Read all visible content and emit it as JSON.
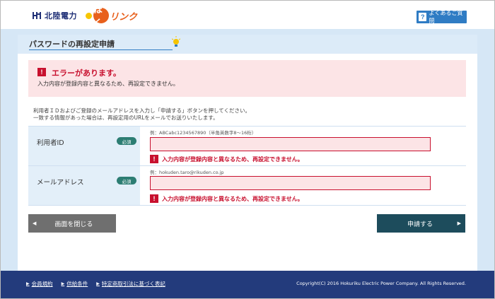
{
  "header": {
    "brand_name": "北陸電力",
    "service_logo_main": "ほく",
    "service_logo_sub": "リンク",
    "faq_icon": "?",
    "faq_label": "よくあるご質問"
  },
  "page": {
    "title": "パスワードの再設定申請"
  },
  "error": {
    "icon": "!",
    "title": "エラーがあります。",
    "message": "入力内容が登録内容と異なるため、再設定できません。"
  },
  "instructions": {
    "line1": "利用者ＩＤおよびご登録のメールアドレスを入力し「申請する」ボタンを押してください。",
    "line2": "一致する情報があった場合は、再設定用のURLをメールでお送りいたします。"
  },
  "form": {
    "user_id": {
      "label": "利用者ID",
      "required_badge": "必須",
      "example": "例：ABCabc1234567890（半角英数字8～16桁）",
      "value": "",
      "error": "入力内容が登録内容と異なるため、再設定できません。"
    },
    "email": {
      "label": "メールアドレス",
      "required_badge": "必須",
      "example": "例：hokuden.taro@rikuden.co.jp",
      "value": "",
      "error": "入力内容が登録内容と異なるため、再設定できません。"
    }
  },
  "buttons": {
    "close_label": "画面を閉じる",
    "submit_label": "申請する"
  },
  "footer": {
    "links": [
      "会員規約",
      "供給条件",
      "特定商取引法に基づく表記"
    ],
    "copyright": "Copyright(C) 2016 Hokuriku Electric Power Company. All Rights Reserved."
  },
  "colors": {
    "brand_navy": "#233b7c",
    "error_red": "#c8102e",
    "error_bg": "#fce4e6",
    "faq_blue": "#2f7cc4",
    "submit_teal": "#1d4c5c",
    "required_green": "#2c7d73"
  }
}
